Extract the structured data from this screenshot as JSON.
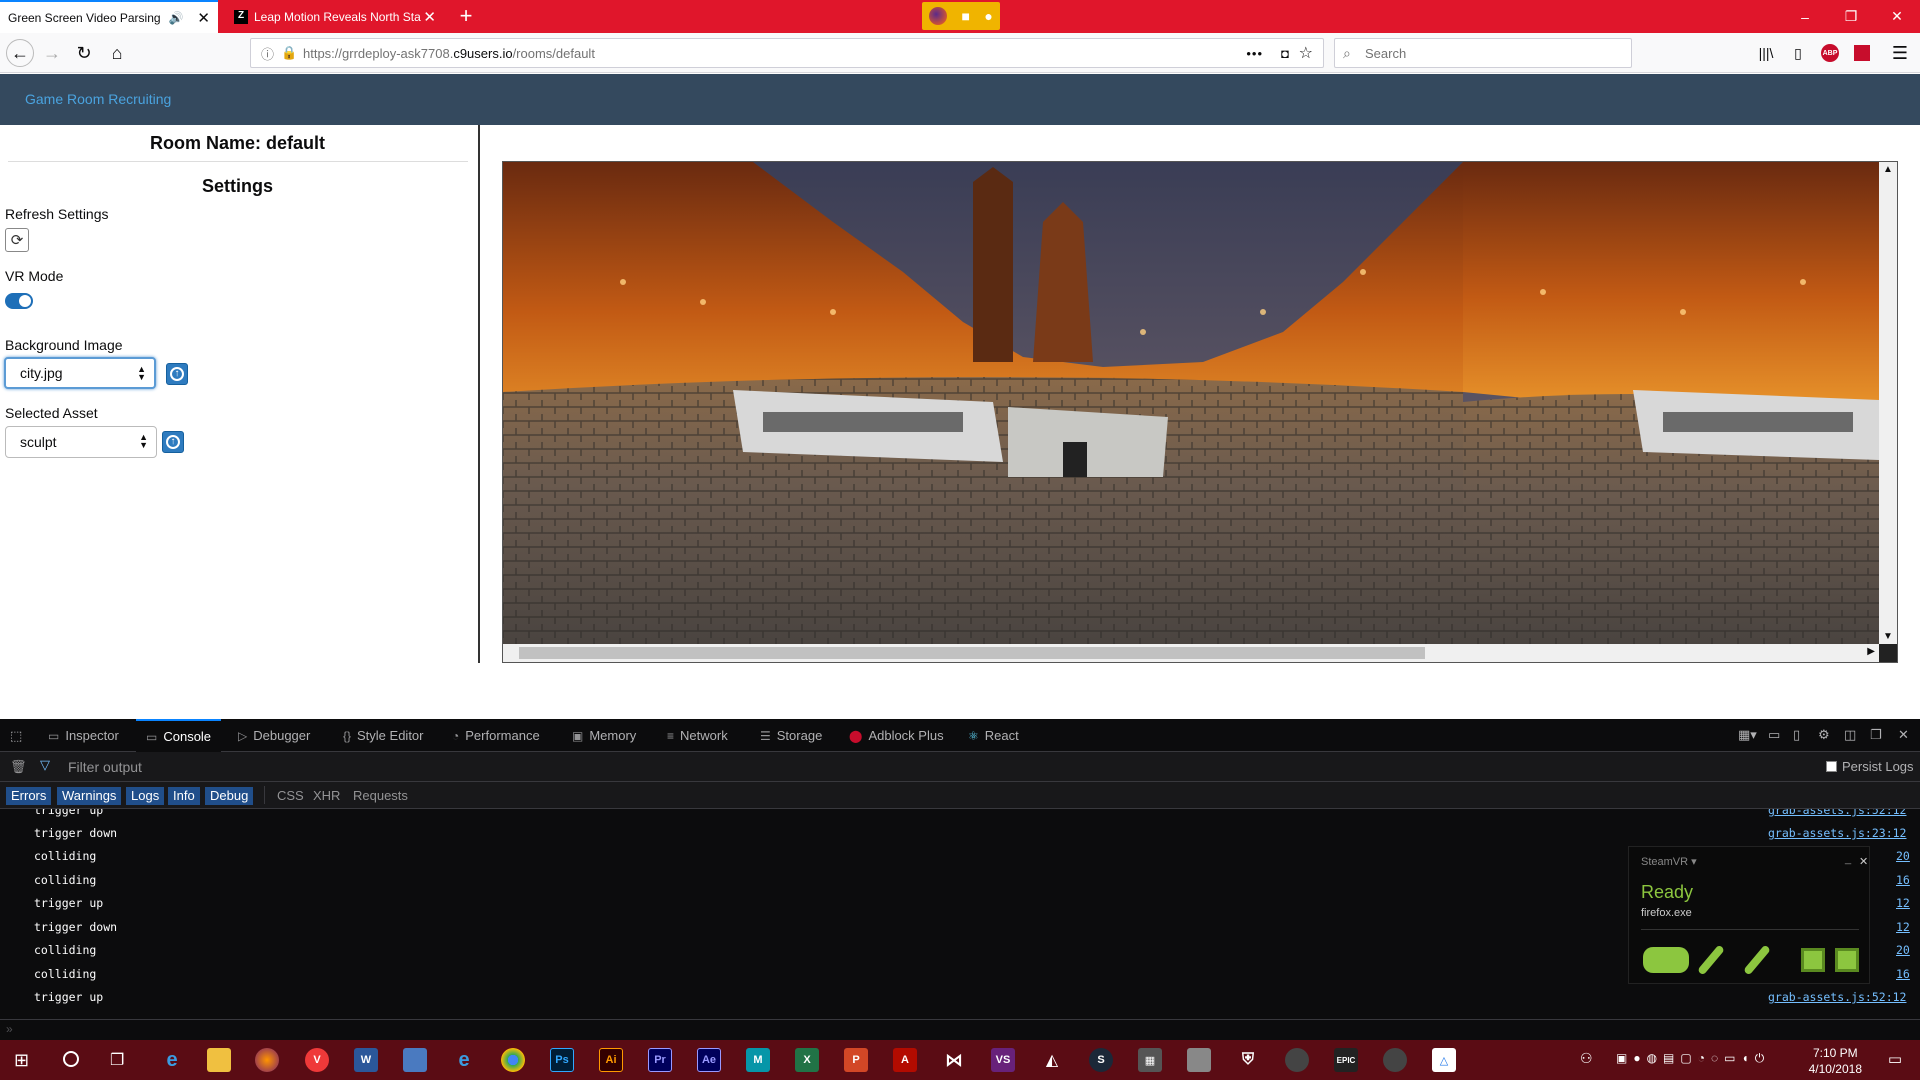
{
  "browser": {
    "tabs": [
      {
        "title": "Green Screen Video Parsing",
        "active": true
      },
      {
        "title": "Leap Motion Reveals North Sta",
        "active": false
      }
    ],
    "url_prefix": "https://grrdeploy-ask7708.",
    "url_domain": "c9users.io",
    "url_path": "/rooms/default",
    "search_placeholder": "Search",
    "accent": "#e0162b"
  },
  "app": {
    "brand": "Game Room Recruiting",
    "room_title": "Room Name: default",
    "settings_title": "Settings",
    "refresh_label": "Refresh Settings",
    "vr_mode_label": "VR Mode",
    "vr_mode_on": true,
    "background_label": "Background Image",
    "background_value": "city.jpg",
    "asset_label": "Selected Asset",
    "asset_value": "sculpt"
  },
  "devtools": {
    "tabs": [
      "Inspector",
      "Console",
      "Debugger",
      "Style Editor",
      "Performance",
      "Memory",
      "Network",
      "Storage",
      "Adblock Plus",
      "React"
    ],
    "active_tab": "Console",
    "filter_placeholder": "Filter output",
    "persist_logs": "Persist Logs",
    "filters_on": [
      "Errors",
      "Warnings",
      "Logs",
      "Info",
      "Debug"
    ],
    "filters_off": [
      "CSS",
      "XHR",
      "Requests"
    ],
    "lines": [
      {
        "text": "trigger up",
        "loc": "grab-assets.js:52:12"
      },
      {
        "text": "trigger down",
        "loc": "grab-assets.js:23:12"
      },
      {
        "text": "colliding",
        "loc": "20"
      },
      {
        "text": "colliding",
        "loc": "16"
      },
      {
        "text": "trigger up",
        "loc": "12"
      },
      {
        "text": "trigger down",
        "loc": "12"
      },
      {
        "text": "colliding",
        "loc": "20"
      },
      {
        "text": "colliding",
        "loc": "16"
      },
      {
        "text": "trigger up",
        "loc": "grab-assets.js:52:12"
      }
    ]
  },
  "steamvr": {
    "title": "SteamVR ▾",
    "status": "Ready",
    "process": "firefox.exe",
    "status_color": "#8cc63f"
  },
  "taskbar": {
    "time": "7:10 PM",
    "date": "4/10/2018"
  }
}
